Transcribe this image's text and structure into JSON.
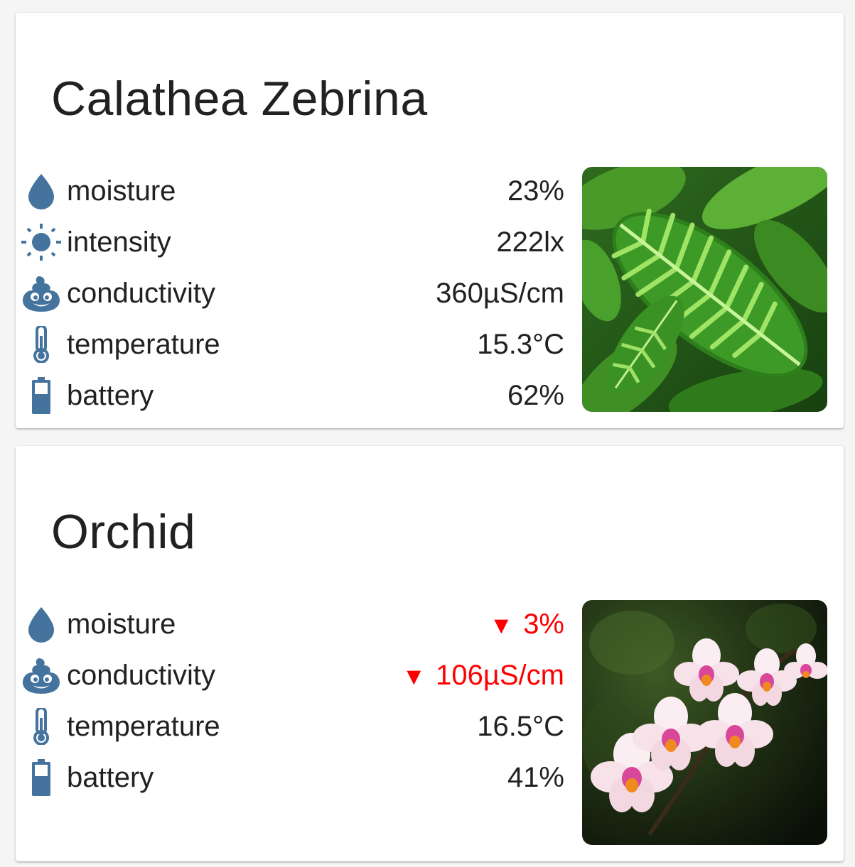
{
  "colors": {
    "icon": "#44739e",
    "alert": "#ff0000",
    "text": "#212121"
  },
  "plants": [
    {
      "name": "Calathea Zebrina",
      "photo": "calathea-zebrina-leaves",
      "sensors": [
        {
          "icon": "water-drop-icon",
          "label": "moisture",
          "value": "23%",
          "low": false
        },
        {
          "icon": "sun-icon",
          "label": "intensity",
          "value": "222lx",
          "low": false
        },
        {
          "icon": "emoticon-poop-icon",
          "label": "conductivity",
          "value": "360µS/cm",
          "low": false
        },
        {
          "icon": "thermometer-icon",
          "label": "temperature",
          "value": "15.3°C",
          "low": false
        },
        {
          "icon": "battery-icon",
          "label": "battery",
          "value": "62%",
          "low": false
        }
      ]
    },
    {
      "name": "Orchid",
      "photo": "orchid-flowers",
      "sensors": [
        {
          "icon": "water-drop-icon",
          "label": "moisture",
          "value": "3%",
          "low": true,
          "arrow": "▼"
        },
        {
          "icon": "emoticon-poop-icon",
          "label": "conductivity",
          "value": "106µS/cm",
          "low": true,
          "arrow": "▼"
        },
        {
          "icon": "thermometer-icon",
          "label": "temperature",
          "value": "16.5°C",
          "low": false
        },
        {
          "icon": "battery-icon",
          "label": "battery",
          "value": "41%",
          "low": false
        }
      ]
    }
  ]
}
